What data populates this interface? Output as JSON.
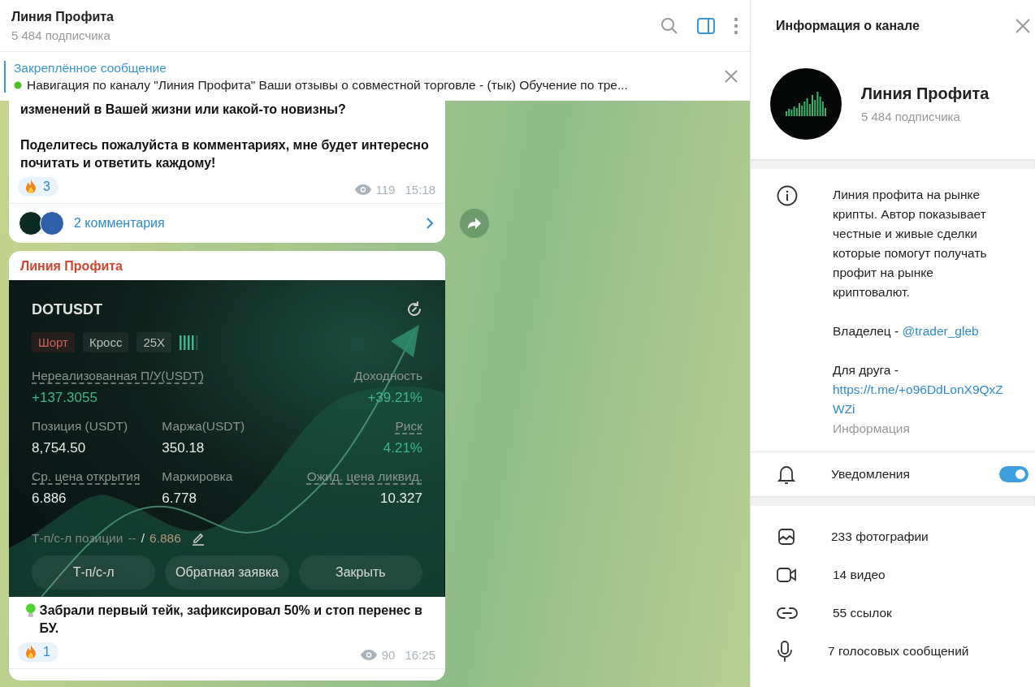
{
  "chat_header": {
    "title": "Линия Профита",
    "subtitle": "5 484 подписчика"
  },
  "pinned": {
    "label": "Закреплённое сообщение",
    "text": "Навигация по каналу \"Линия Профита\"  Ваши отзывы о совместной торговле - (тык) Обучение по тре..."
  },
  "messages": [
    {
      "paragraphs": [
        "изменений в Вашей жизни или какой-то новизны?",
        "Поделитесь пожалуйста в комментариях, мне будет интересно почитать и ответить каждому!"
      ],
      "reaction_count": "3",
      "views": "119",
      "time": "15:18",
      "comments": "2 комментария"
    },
    {
      "author": "Линия Профита",
      "screenshot": {
        "pair": "DOTUSDT",
        "chips": [
          {
            "label": "Шорт",
            "kind": "side"
          },
          {
            "label": "Кросс",
            "kind": "plain"
          },
          {
            "label": "25X",
            "kind": "plain"
          }
        ],
        "pnl": {
          "label": "Нереализованная П/У(USDT)",
          "value": "+137.3055",
          "underlined": true
        },
        "roi": {
          "label": "Доходность",
          "value": "+39.21%",
          "underlined": false
        },
        "stats": [
          {
            "label": "Позиция (USDT)",
            "value": "8,754.50",
            "kind": "neutral",
            "underlined": false
          },
          {
            "label": "Маржа(USDT)",
            "value": "350.18",
            "kind": "neutral",
            "underlined": false
          },
          {
            "label": "Риск",
            "value": "4.21%",
            "kind": "positive",
            "underlined": true
          },
          {
            "label": "Ср. цена открытия",
            "value": "6.886",
            "kind": "neutral",
            "underlined": true
          },
          {
            "label": "Маркировка",
            "value": "6.778",
            "kind": "neutral",
            "underlined": false
          },
          {
            "label": "Ожид. цена ликвид.",
            "value": "10.327",
            "kind": "neutral",
            "underlined": true
          }
        ],
        "tpsl": {
          "label": "Т-п/с-л позиции",
          "take": "--",
          "separator": "/",
          "stop": "6.886"
        },
        "buttons": [
          "Т-п/с-л",
          "Обратная заявка",
          "Закрыть"
        ]
      },
      "caption": "Забрали первый тейк, зафиксировал 50% и стоп перенес в БУ.",
      "reaction_count": "1",
      "views": "90",
      "time": "16:25"
    }
  ],
  "info_panel": {
    "title": "Информация о канале",
    "channel": {
      "name": "Линия Профита",
      "subscribers": "5 484 подписчика"
    },
    "about": {
      "description": "Линия профита на рынке крипты. Автор показывает честные и живые сделки которые помогут получать профит на рынке криптовалют.",
      "owner_label": "Владелец - ",
      "owner_link": "@trader_gleb",
      "friend_label": "Для друга -",
      "friend_link": "https://t.me/+o96DdLonX9QxZWZi",
      "caption": "Информация"
    },
    "notifications": {
      "label": "Уведомления",
      "on": true
    },
    "media": [
      {
        "kind": "photo",
        "label": "233 фотографии"
      },
      {
        "kind": "video",
        "label": "14 видео"
      },
      {
        "kind": "link",
        "label": "55 ссылок"
      },
      {
        "kind": "voice",
        "label": "7 голосовых сообщений"
      }
    ]
  }
}
